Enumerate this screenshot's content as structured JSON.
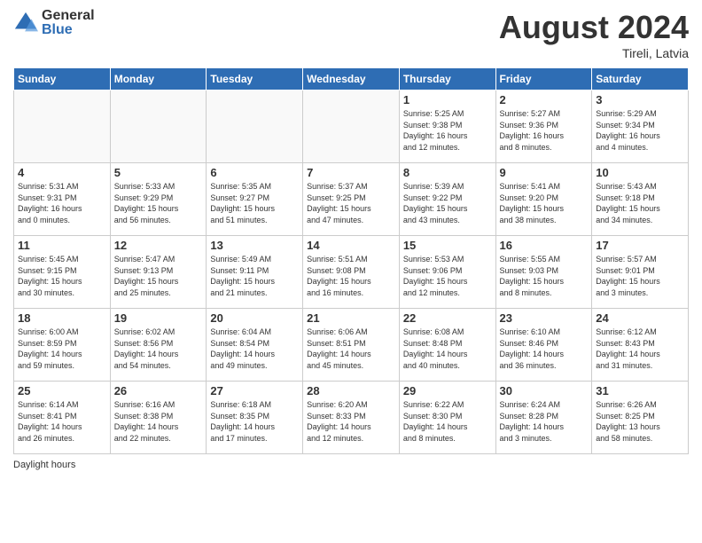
{
  "logo": {
    "general": "General",
    "blue": "Blue"
  },
  "title": "August 2024",
  "subtitle": "Tireli, Latvia",
  "days_of_week": [
    "Sunday",
    "Monday",
    "Tuesday",
    "Wednesday",
    "Thursday",
    "Friday",
    "Saturday"
  ],
  "footer": "Daylight hours",
  "weeks": [
    [
      {
        "day": "",
        "info": ""
      },
      {
        "day": "",
        "info": ""
      },
      {
        "day": "",
        "info": ""
      },
      {
        "day": "",
        "info": ""
      },
      {
        "day": "1",
        "info": "Sunrise: 5:25 AM\nSunset: 9:38 PM\nDaylight: 16 hours\nand 12 minutes."
      },
      {
        "day": "2",
        "info": "Sunrise: 5:27 AM\nSunset: 9:36 PM\nDaylight: 16 hours\nand 8 minutes."
      },
      {
        "day": "3",
        "info": "Sunrise: 5:29 AM\nSunset: 9:34 PM\nDaylight: 16 hours\nand 4 minutes."
      }
    ],
    [
      {
        "day": "4",
        "info": "Sunrise: 5:31 AM\nSunset: 9:31 PM\nDaylight: 16 hours\nand 0 minutes."
      },
      {
        "day": "5",
        "info": "Sunrise: 5:33 AM\nSunset: 9:29 PM\nDaylight: 15 hours\nand 56 minutes."
      },
      {
        "day": "6",
        "info": "Sunrise: 5:35 AM\nSunset: 9:27 PM\nDaylight: 15 hours\nand 51 minutes."
      },
      {
        "day": "7",
        "info": "Sunrise: 5:37 AM\nSunset: 9:25 PM\nDaylight: 15 hours\nand 47 minutes."
      },
      {
        "day": "8",
        "info": "Sunrise: 5:39 AM\nSunset: 9:22 PM\nDaylight: 15 hours\nand 43 minutes."
      },
      {
        "day": "9",
        "info": "Sunrise: 5:41 AM\nSunset: 9:20 PM\nDaylight: 15 hours\nand 38 minutes."
      },
      {
        "day": "10",
        "info": "Sunrise: 5:43 AM\nSunset: 9:18 PM\nDaylight: 15 hours\nand 34 minutes."
      }
    ],
    [
      {
        "day": "11",
        "info": "Sunrise: 5:45 AM\nSunset: 9:15 PM\nDaylight: 15 hours\nand 30 minutes."
      },
      {
        "day": "12",
        "info": "Sunrise: 5:47 AM\nSunset: 9:13 PM\nDaylight: 15 hours\nand 25 minutes."
      },
      {
        "day": "13",
        "info": "Sunrise: 5:49 AM\nSunset: 9:11 PM\nDaylight: 15 hours\nand 21 minutes."
      },
      {
        "day": "14",
        "info": "Sunrise: 5:51 AM\nSunset: 9:08 PM\nDaylight: 15 hours\nand 16 minutes."
      },
      {
        "day": "15",
        "info": "Sunrise: 5:53 AM\nSunset: 9:06 PM\nDaylight: 15 hours\nand 12 minutes."
      },
      {
        "day": "16",
        "info": "Sunrise: 5:55 AM\nSunset: 9:03 PM\nDaylight: 15 hours\nand 8 minutes."
      },
      {
        "day": "17",
        "info": "Sunrise: 5:57 AM\nSunset: 9:01 PM\nDaylight: 15 hours\nand 3 minutes."
      }
    ],
    [
      {
        "day": "18",
        "info": "Sunrise: 6:00 AM\nSunset: 8:59 PM\nDaylight: 14 hours\nand 59 minutes."
      },
      {
        "day": "19",
        "info": "Sunrise: 6:02 AM\nSunset: 8:56 PM\nDaylight: 14 hours\nand 54 minutes."
      },
      {
        "day": "20",
        "info": "Sunrise: 6:04 AM\nSunset: 8:54 PM\nDaylight: 14 hours\nand 49 minutes."
      },
      {
        "day": "21",
        "info": "Sunrise: 6:06 AM\nSunset: 8:51 PM\nDaylight: 14 hours\nand 45 minutes."
      },
      {
        "day": "22",
        "info": "Sunrise: 6:08 AM\nSunset: 8:48 PM\nDaylight: 14 hours\nand 40 minutes."
      },
      {
        "day": "23",
        "info": "Sunrise: 6:10 AM\nSunset: 8:46 PM\nDaylight: 14 hours\nand 36 minutes."
      },
      {
        "day": "24",
        "info": "Sunrise: 6:12 AM\nSunset: 8:43 PM\nDaylight: 14 hours\nand 31 minutes."
      }
    ],
    [
      {
        "day": "25",
        "info": "Sunrise: 6:14 AM\nSunset: 8:41 PM\nDaylight: 14 hours\nand 26 minutes."
      },
      {
        "day": "26",
        "info": "Sunrise: 6:16 AM\nSunset: 8:38 PM\nDaylight: 14 hours\nand 22 minutes."
      },
      {
        "day": "27",
        "info": "Sunrise: 6:18 AM\nSunset: 8:35 PM\nDaylight: 14 hours\nand 17 minutes."
      },
      {
        "day": "28",
        "info": "Sunrise: 6:20 AM\nSunset: 8:33 PM\nDaylight: 14 hours\nand 12 minutes."
      },
      {
        "day": "29",
        "info": "Sunrise: 6:22 AM\nSunset: 8:30 PM\nDaylight: 14 hours\nand 8 minutes."
      },
      {
        "day": "30",
        "info": "Sunrise: 6:24 AM\nSunset: 8:28 PM\nDaylight: 14 hours\nand 3 minutes."
      },
      {
        "day": "31",
        "info": "Sunrise: 6:26 AM\nSunset: 8:25 PM\nDaylight: 13 hours\nand 58 minutes."
      }
    ]
  ]
}
